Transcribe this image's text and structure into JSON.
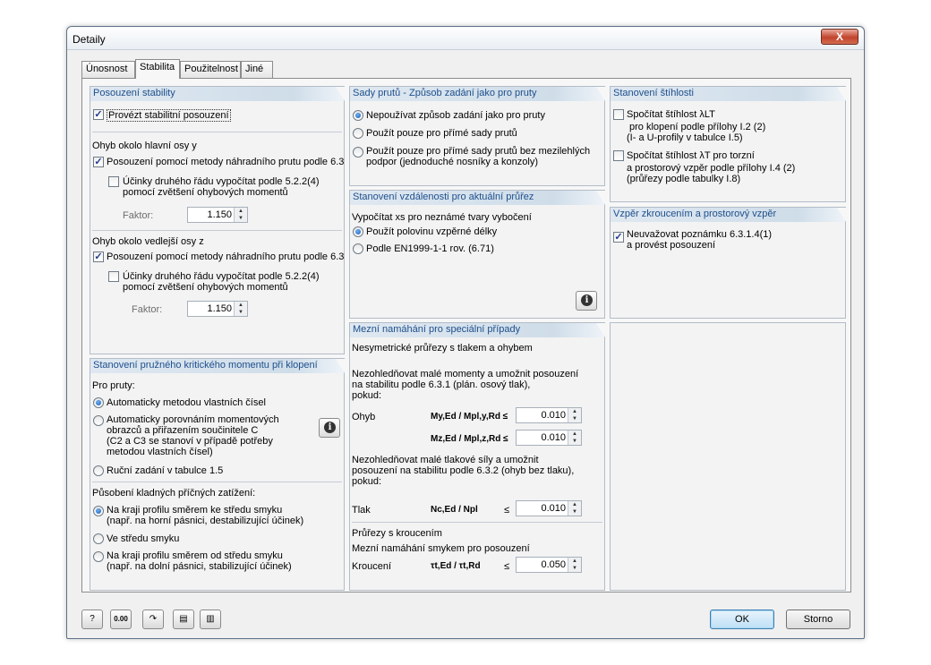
{
  "window": {
    "title": "Detaily",
    "close_label": "X"
  },
  "tabs": [
    "Únosnost",
    "Stabilita",
    "Použitelnost",
    "Jiné"
  ],
  "stability": {
    "header": "Posouzení stability",
    "perform_check": "Provézt stabilitní posouzení",
    "major_axis_title": "Ohyb okolo hlavní osy y",
    "major_method": "Posouzení pomocí metody náhradního prutu podle 6.3",
    "major_second_order_1": "Účinky druhého řádu vypočítat podle 5.2.2(4)",
    "major_second_order_2": "pomocí zvětšení ohybových momentů",
    "factor_label": "Faktor:",
    "major_factor": "1.150",
    "minor_axis_title": "Ohyb okolo vedlejší osy z",
    "minor_method": "Posouzení pomocí metody náhradního prutu podle 6.3",
    "minor_second_order_1": "Účinky druhého řádu vypočítat podle 5.2.2(4)",
    "minor_second_order_2": "pomocí zvětšení ohybových momentů",
    "minor_factor": "1.150"
  },
  "critical_moment": {
    "header": "Stanovení pružného kritického momentu při klopení",
    "for_members": "Pro pruty:",
    "opt1": "Automaticky metodou vlastních čísel",
    "opt2_1": "Automaticky porovnáním momentových",
    "opt2_2": "obrazců a přiřazením součinitele C",
    "opt2_3": "(C2 a C3 se stanoví v případě potřeby",
    "opt2_4": "metodou vlastních čísel)",
    "opt3": "Ruční zadání v tabulce 1.5",
    "load_title": "Působení kladných příčných zatížení:",
    "load1_1": "Na kraji profilu směrem ke středu smyku",
    "load1_2": "(např. na horní pásnici, destabilizující účinek)",
    "load2": "Ve středu smyku",
    "load3_1": "Na kraji profilu směrem od středu smyku",
    "load3_2": "(např. na dolní pásnici, stabilizující účinek)"
  },
  "member_sets": {
    "header": "Sady prutů - Způsob zadání jako pro pruty",
    "opt1": "Nepoužívat způsob zadání jako pro pruty",
    "opt2": "Použít pouze pro přímé sady prutů",
    "opt3_1": "Použít pouze pro přímé sady prutů bez mezilehlých",
    "opt3_2": "podpor (jednoduché nosníky a konzoly)"
  },
  "distance": {
    "header": "Stanovení vzdálenosti pro aktuální průřez",
    "calc_label": "Vypočítat xs pro neznámé tvary vybočení",
    "opt1": "Použít polovinu vzpěrné délky",
    "opt2": "Podle EN1999-1-1 rov. (6.71)"
  },
  "limit_stresses": {
    "header": "Mezní namáhání pro speciální případy",
    "subtitle": "Nesymetrické průřezy s tlakem a ohybem",
    "ignore_moments_1": "Nezohledňovat malé momenty a umožnit posouzení",
    "ignore_moments_2": "na stabilitu podle 6.3.1 (plán. osový tlak),",
    "ignore_moments_3": "pokud:",
    "bending_label": "Ohyb",
    "my_ratio": "My,Ed / Mpl,y,Rd ≤",
    "my_value": "0.010",
    "mz_ratio": "Mz,Ed / Mpl,z,Rd ≤",
    "mz_value": "0.010",
    "ignore_comp_1": "Nezohledňovat malé tlakové síly a umožnit",
    "ignore_comp_2": "posouzení na stabilitu podle 6.3.2 (ohyb bez tlaku),",
    "ignore_comp_3": "pokud:",
    "compression_label": "Tlak",
    "n_ratio": "Nc,Ed / Npl",
    "n_le": "≤",
    "n_value": "0.010",
    "torsion_title": "Průřezy s kroucením",
    "torsion_sub": "Mezní namáhání smykem pro posouzení",
    "torsion_label": "Kroucení",
    "t_ratio": "τt,Ed / τt,Rd",
    "t_le": "≤",
    "t_value": "0.050"
  },
  "slenderness": {
    "header": "Stanovení štíhlosti",
    "cb1_1": "Spočítat štíhlost λLT",
    "cb1_2": "pro klopení podle přílohy I.2 (2)",
    "cb1_3": "(I- a U-profily v tabulce I.5)",
    "cb2_1": "Spočítat štíhlost λT pro torzní",
    "cb2_2": "a prostorový vzpěr podle přílohy I.4 (2)",
    "cb2_3": "(průřezy podle tabulky I.8)"
  },
  "torsional_buckling": {
    "header": "Vzpěr zkroucením a prostorový vzpěr",
    "cb1_1": "Neuvažovat poznámku 6.3.1.4(1)",
    "cb1_2": "a provést posouzení"
  },
  "footer": {
    "ok": "OK",
    "cancel": "Storno",
    "decimal_icon_text": "0.00"
  }
}
